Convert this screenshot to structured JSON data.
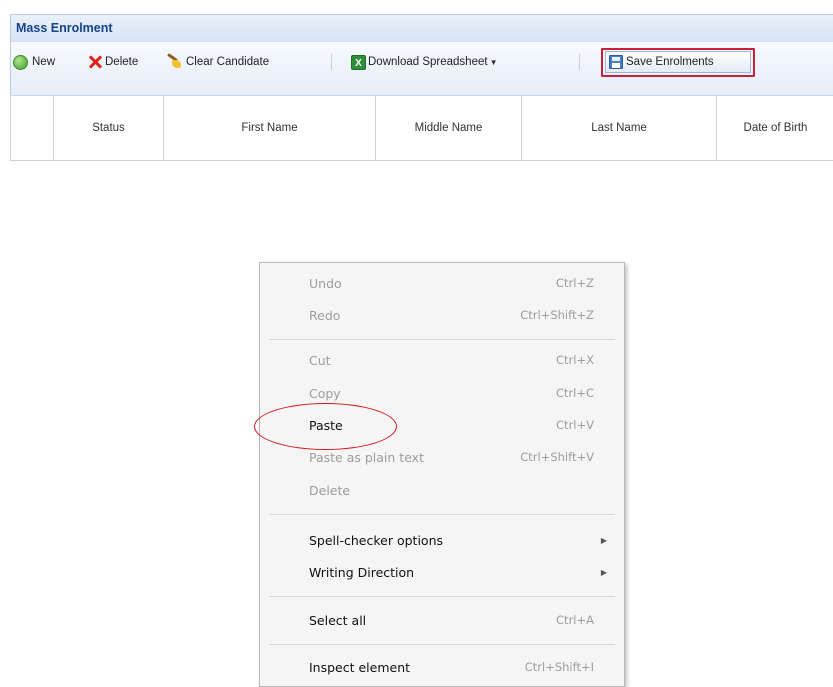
{
  "panel": {
    "title": "Mass Enrolment"
  },
  "toolbar": {
    "new_label": "New",
    "delete_label": "Delete",
    "clear_candidate_label": "Clear Candidate",
    "download_label": "Download Spreadsheet",
    "save_label": "Save Enrolments",
    "highlight_color": "#c6203a"
  },
  "grid": {
    "columns": [
      "",
      "Status",
      "First Name",
      "Middle Name",
      "Last Name",
      "Date of Birth"
    ]
  },
  "context_menu": {
    "items": [
      {
        "label": "Undo",
        "shortcut": "Ctrl+Z"
      },
      {
        "label": "Redo",
        "shortcut": "Ctrl+Shift+Z"
      },
      {
        "label": "Cut",
        "shortcut": "Ctrl+X"
      },
      {
        "label": "Copy",
        "shortcut": "Ctrl+C"
      },
      {
        "label": "Paste",
        "shortcut": "Ctrl+V"
      },
      {
        "label": "Paste as plain text",
        "shortcut": "Ctrl+Shift+V"
      },
      {
        "label": "Delete",
        "shortcut": ""
      },
      {
        "label": "Spell-checker options",
        "shortcut": ""
      },
      {
        "label": "Writing Direction",
        "shortcut": ""
      },
      {
        "label": "Select all",
        "shortcut": "Ctrl+A"
      },
      {
        "label": "Inspect element",
        "shortcut": "Ctrl+Shift+I"
      }
    ],
    "annotation_color": "#d4161b"
  }
}
